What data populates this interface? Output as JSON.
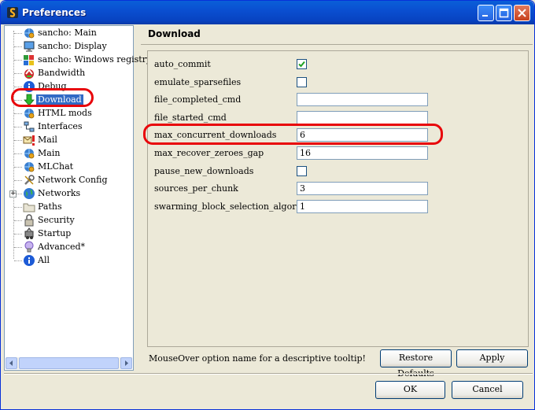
{
  "window": {
    "title": "Preferences"
  },
  "tree": {
    "items": [
      {
        "label": "sancho: Main",
        "icon": "globe-gear-icon"
      },
      {
        "label": "sancho: Display",
        "icon": "monitor-icon"
      },
      {
        "label": "sancho: Windows registry",
        "icon": "registry-icon"
      },
      {
        "label": "Bandwidth",
        "icon": "bandwidth-icon"
      },
      {
        "label": "Debug",
        "icon": "info-icon"
      },
      {
        "label": "Download",
        "icon": "download-arrow-icon"
      },
      {
        "label": "HTML mods",
        "icon": "globe-gear-icon"
      },
      {
        "label": "Interfaces",
        "icon": "network-icon"
      },
      {
        "label": "Mail",
        "icon": "mail-alert-icon"
      },
      {
        "label": "Main",
        "icon": "globe-gear-icon"
      },
      {
        "label": "MLChat",
        "icon": "globe-gear-icon"
      },
      {
        "label": "Network Config",
        "icon": "tools-icon"
      },
      {
        "label": "Networks",
        "icon": "globe-icon"
      },
      {
        "label": "Paths",
        "icon": "folder-icon"
      },
      {
        "label": "Security",
        "icon": "lock-icon"
      },
      {
        "label": "Startup",
        "icon": "startup-icon"
      },
      {
        "label": "Advanced*",
        "icon": "lightbulb-icon"
      },
      {
        "label": "All",
        "icon": "info-icon"
      }
    ],
    "selected": "Download"
  },
  "panel": {
    "title": "Download",
    "options": [
      {
        "name": "auto_commit",
        "type": "checkbox",
        "checked": true
      },
      {
        "name": "emulate_sparsefiles",
        "type": "checkbox",
        "checked": false
      },
      {
        "name": "file_completed_cmd",
        "type": "text",
        "value": ""
      },
      {
        "name": "file_started_cmd",
        "type": "text",
        "value": ""
      },
      {
        "name": "max_concurrent_downloads",
        "type": "text",
        "value": "6"
      },
      {
        "name": "max_recover_zeroes_gap",
        "type": "text",
        "value": "16"
      },
      {
        "name": "pause_new_downloads",
        "type": "checkbox",
        "checked": false
      },
      {
        "name": "sources_per_chunk",
        "type": "text",
        "value": "3"
      },
      {
        "name": "swarming_block_selection_algorithm",
        "type": "text",
        "value": "1"
      }
    ]
  },
  "footer": {
    "hint": "MouseOver option name for a descriptive tooltip!",
    "restore_label": "Restore Defaults",
    "apply_label": "Apply",
    "ok_label": "OK",
    "cancel_label": "Cancel"
  },
  "colors": {
    "title_bar": "#0a4fd1",
    "selection": "#316ac5",
    "highlight_ring": "#e8060b"
  }
}
